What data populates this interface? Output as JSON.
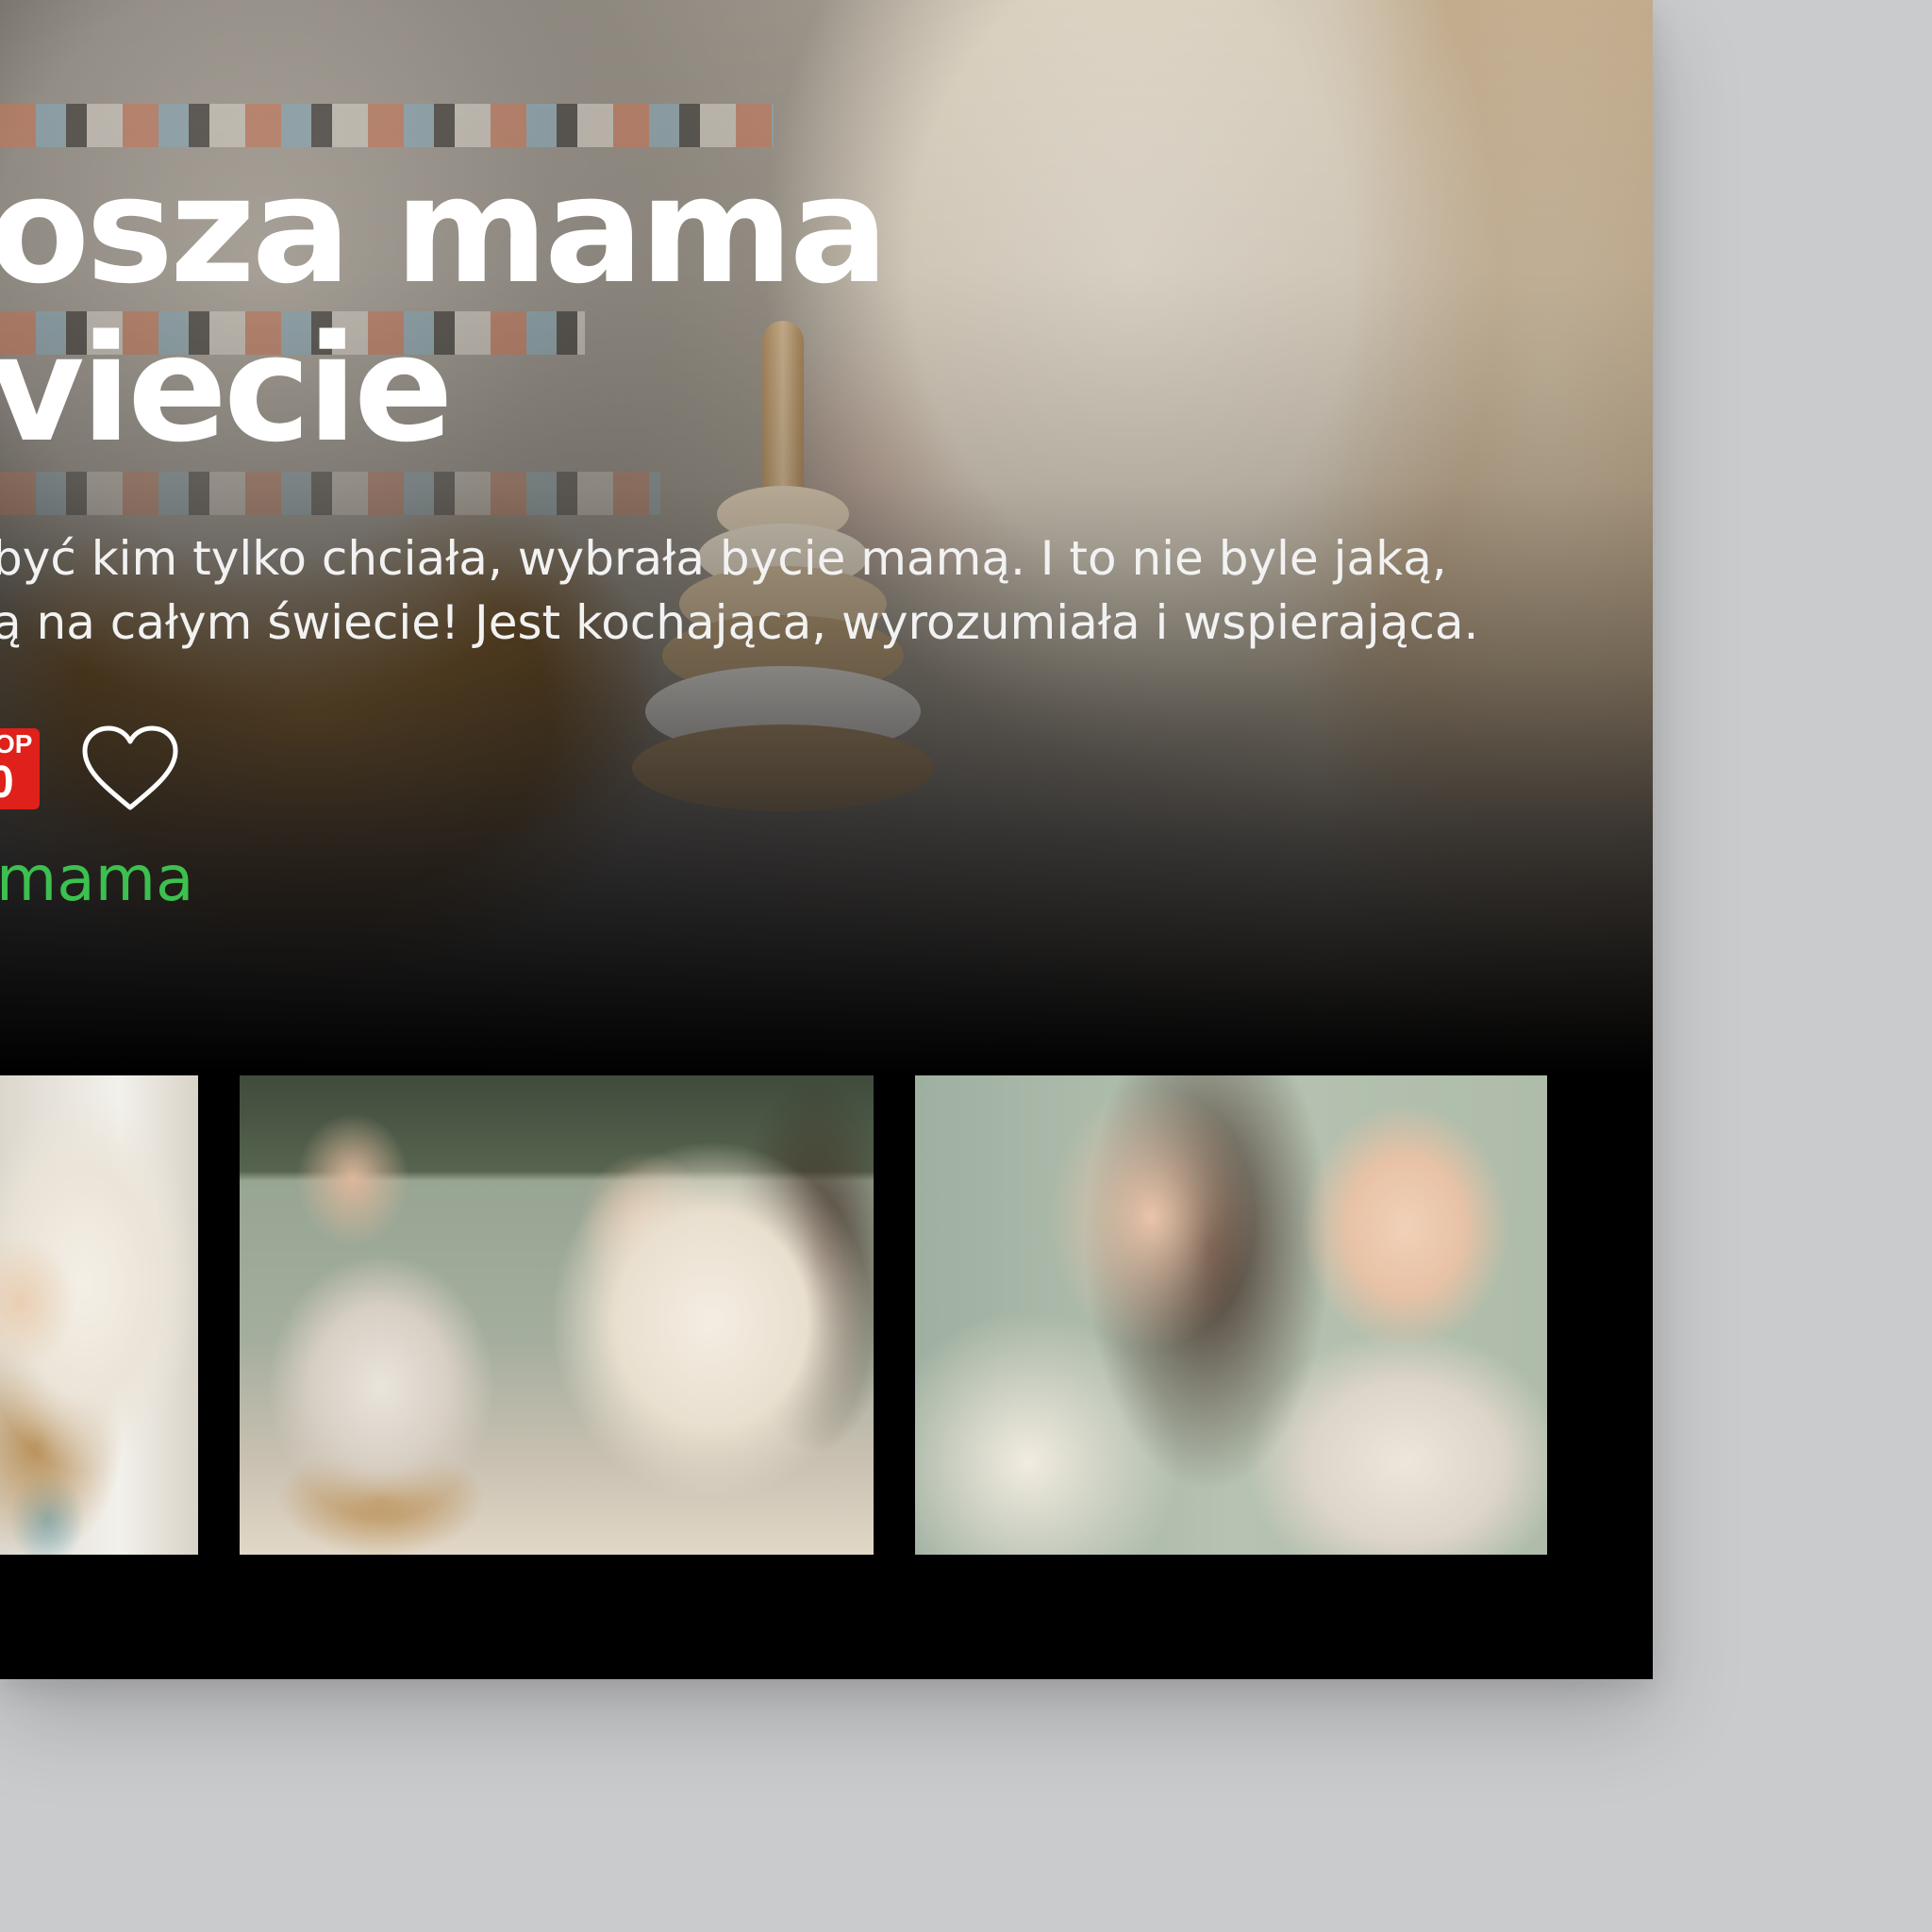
{
  "article": {
    "title_line1": "osza mama",
    "title_line2": "viecie",
    "description_line1": "być kim tylko chciała, wybrała bycie mamą. I to nie byle jaką,",
    "description_line2": "ą na całym świecie! Jest kochająca, wyrozumiała i wspierająca.",
    "badge_top": "OP",
    "badge_bottom": "0",
    "category_link": "mama"
  },
  "colors": {
    "accent_green": "#3cc04f",
    "badge_red": "#e0201a",
    "card_background": "#000000",
    "page_background": "#cacbcd"
  },
  "icons": {
    "favorite": "heart-outline-icon"
  },
  "gallery": {
    "images": [
      {
        "name": "thumb-baby-in-chair"
      },
      {
        "name": "thumb-mother-playing-with-baby"
      },
      {
        "name": "thumb-mother-and-baby-portrait"
      }
    ]
  }
}
